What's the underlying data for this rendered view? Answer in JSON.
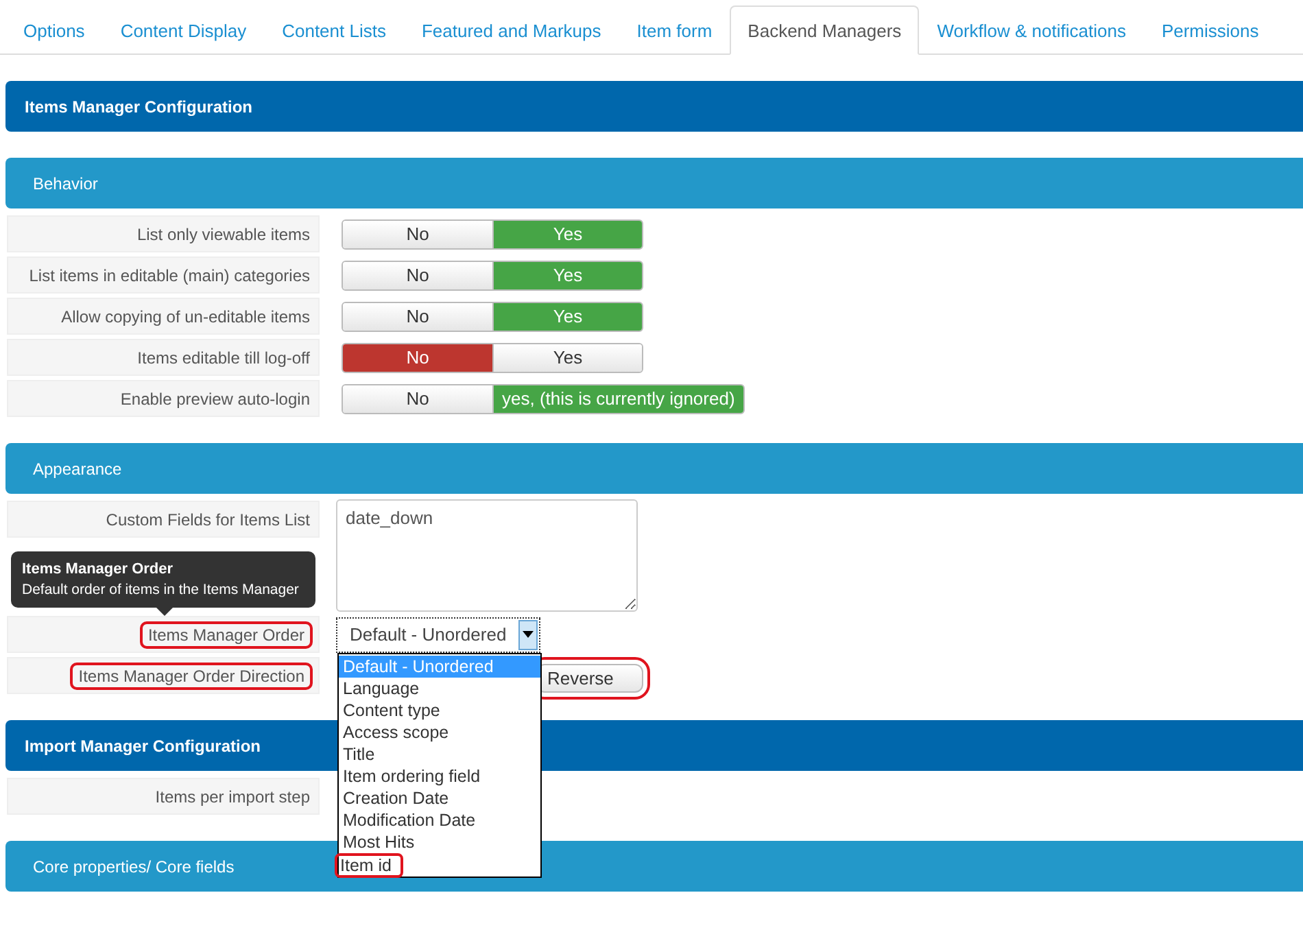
{
  "tabs": [
    {
      "label": "Options",
      "selected": false
    },
    {
      "label": "Content Display",
      "selected": false
    },
    {
      "label": "Content Lists",
      "selected": false
    },
    {
      "label": "Featured and Markups",
      "selected": false
    },
    {
      "label": "Item form",
      "selected": false
    },
    {
      "label": "Backend Managers",
      "selected": true
    },
    {
      "label": "Workflow & notifications",
      "selected": false
    },
    {
      "label": "Permissions",
      "selected": false
    }
  ],
  "sections": [
    {
      "kind": "group",
      "title": "Items Manager Configuration"
    },
    {
      "kind": "subgroup",
      "title": "Behavior",
      "rows": [
        {
          "label": "List only viewable items",
          "kind": "toggle",
          "options": [
            {
              "label": "No",
              "kind": "no",
              "selected": false
            },
            {
              "label": "Yes",
              "kind": "yes",
              "selected": true
            }
          ]
        },
        {
          "label": "List items in editable (main) categories",
          "kind": "toggle",
          "options": [
            {
              "label": "No",
              "kind": "no",
              "selected": false
            },
            {
              "label": "Yes",
              "kind": "yes",
              "selected": true
            }
          ]
        },
        {
          "label": "Allow copying of un-editable items",
          "kind": "toggle",
          "options": [
            {
              "label": "No",
              "kind": "no",
              "selected": false
            },
            {
              "label": "Yes",
              "kind": "yes",
              "selected": true
            }
          ]
        },
        {
          "label": "Items editable till log-off",
          "kind": "toggle",
          "options": [
            {
              "label": "No",
              "kind": "no",
              "selected": true
            },
            {
              "label": "Yes",
              "kind": "yes",
              "selected": false
            }
          ]
        },
        {
          "label": "Enable preview auto-login",
          "kind": "toggle",
          "options": [
            {
              "label": "No",
              "kind": "no",
              "selected": false
            },
            {
              "label": "yes, (this is currently ignored)",
              "kind": "yes",
              "selected": true
            }
          ]
        }
      ]
    },
    {
      "kind": "subgroup",
      "title": "Appearance",
      "rows": [
        {
          "label": "Custom Fields for Items List",
          "kind": "textarea",
          "value": "date_down"
        },
        {
          "label": "Items Manager Order",
          "kind": "select",
          "highlighted": true,
          "value": "Default - Unordered",
          "expanded": true,
          "tooltip": {
            "title": "Items Manager Order",
            "text": "Default order of items in the Items Manager"
          },
          "options": [
            {
              "label": "Default - Unordered",
              "selected": true,
              "highlighted": false
            },
            {
              "label": "Language",
              "selected": false,
              "highlighted": false
            },
            {
              "label": "Content type",
              "selected": false,
              "highlighted": false
            },
            {
              "label": "Access scope",
              "selected": false,
              "highlighted": false
            },
            {
              "label": "Title",
              "selected": false,
              "highlighted": false
            },
            {
              "label": "Item ordering field",
              "selected": false,
              "highlighted": false
            },
            {
              "label": "Creation Date",
              "selected": false,
              "highlighted": false
            },
            {
              "label": "Modification Date",
              "selected": false,
              "highlighted": false
            },
            {
              "label": "Most Hits",
              "selected": false,
              "highlighted": false
            },
            {
              "label": "Item id",
              "selected": false,
              "highlighted": true
            }
          ]
        },
        {
          "label": "Items Manager Order Direction",
          "kind": "button",
          "highlighted": true,
          "button": {
            "label": "Reverse",
            "highlighted": true
          }
        }
      ]
    },
    {
      "kind": "group",
      "title": "Import Manager Configuration",
      "rows": [
        {
          "label": "Items per import step",
          "kind": "hidden"
        }
      ]
    },
    {
      "kind": "subgroup",
      "title": "Core properties/ Core fields"
    }
  ]
}
